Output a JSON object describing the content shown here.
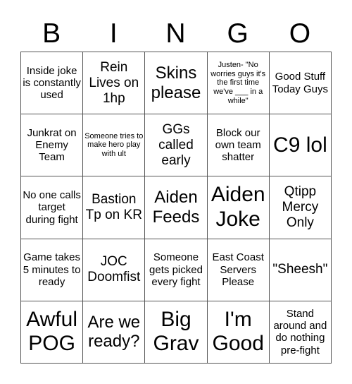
{
  "header": [
    "B",
    "I",
    "N",
    "G",
    "O"
  ],
  "cells": [
    [
      "Inside joke is constantly used",
      "Rein Lives on 1hp",
      "Skins please",
      "Justen- \"No worries guys it's the first time we've ___ in a while\"",
      "Good Stuff Today Guys"
    ],
    [
      "Junkrat on Enemy Team",
      "Someone tries to make hero play with ult",
      "GGs called early",
      "Block our own team shatter",
      "C9 lol"
    ],
    [
      "No one calls target during fight",
      "Bastion Tp on KR",
      "Aiden Feeds",
      "Aiden Joke",
      "Qtipp Mercy Only"
    ],
    [
      "Game takes 5 minutes to ready",
      "JOC Doomfist",
      "Someone gets picked every fight",
      "East Coast Servers Please",
      "\"Sheesh\""
    ],
    [
      "Awful POG",
      "Are we ready?",
      "Big Grav",
      "I'm Good",
      "Stand around and do nothing pre-fight"
    ]
  ]
}
